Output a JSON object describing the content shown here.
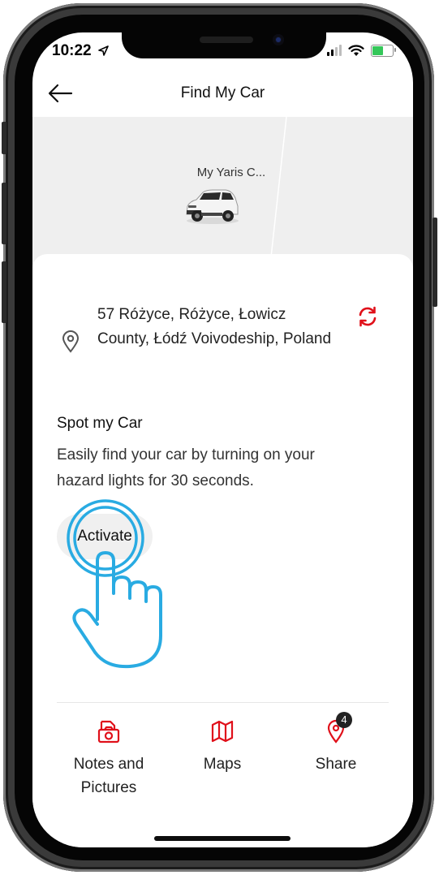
{
  "status_bar": {
    "time": "10:22",
    "location_icon": "location-arrow-icon",
    "signal_icon": "cellular-signal-icon",
    "wifi_icon": "wifi-icon",
    "battery_icon": "battery-charging-icon",
    "battery_color": "#34c759"
  },
  "header": {
    "back_icon": "arrow-left-icon",
    "title": "Find My Car"
  },
  "car_banner": {
    "car_name": "My Yaris C...",
    "background": "#efefef"
  },
  "location": {
    "address": "57 Różyce, Różyce, Łowicz County, Łódź Voivodeship, Poland",
    "pin_icon": "map-pin-icon",
    "refresh_icon": "refresh-icon",
    "accent_color": "#e0101a"
  },
  "spot_my_car": {
    "title": "Spot my Car",
    "description": "Easily find your car by turning on your hazard lights for 30 seconds.",
    "activate_label": "Activate",
    "tap_hint_icon": "tap-hand-icon",
    "tap_hint_color": "#29abe2"
  },
  "bottom_actions": [
    {
      "label": "Notes and Pictures",
      "icon": "notes-pictures-icon"
    },
    {
      "label": "Maps",
      "icon": "map-icon"
    },
    {
      "label": "Share",
      "icon": "share-location-icon",
      "badge": "4"
    }
  ]
}
